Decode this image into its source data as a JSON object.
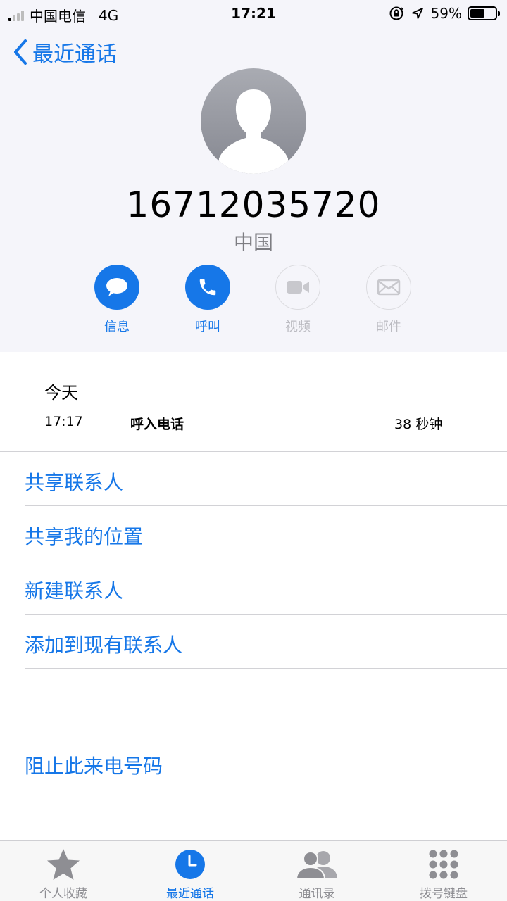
{
  "status_bar": {
    "carrier": "中国电信",
    "network": "4G",
    "time": "17:21",
    "battery_percent": "59%",
    "battery_level": 0.59,
    "signal_bars_active": 1,
    "signal_bars_total": 4
  },
  "nav": {
    "back_label": "最近通话"
  },
  "contact": {
    "number": "16712035720",
    "location": "中国"
  },
  "actions": [
    {
      "label": "信息",
      "icon": "message-icon",
      "enabled": true
    },
    {
      "label": "呼叫",
      "icon": "phone-icon",
      "enabled": true
    },
    {
      "label": "视频",
      "icon": "video-icon",
      "enabled": false
    },
    {
      "label": "邮件",
      "icon": "mail-icon",
      "enabled": false
    }
  ],
  "call_log": {
    "day": "今天",
    "entries": [
      {
        "time": "17:17",
        "type": "呼入电话",
        "duration": "38 秒钟"
      }
    ]
  },
  "options": {
    "share_contact": "共享联系人",
    "share_location": "共享我的位置",
    "new_contact": "新建联系人",
    "add_to_existing": "添加到现有联系人",
    "block_caller": "阻止此来电号码"
  },
  "tabs": [
    {
      "label": "个人收藏",
      "icon": "star-icon",
      "active": false
    },
    {
      "label": "最近通话",
      "icon": "clock-icon",
      "active": true
    },
    {
      "label": "通讯录",
      "icon": "contacts-icon",
      "active": false
    },
    {
      "label": "拨号键盘",
      "icon": "keypad-icon",
      "active": false
    }
  ],
  "colors": {
    "accent": "#1677e8",
    "header_bg": "#f5f5fa",
    "disabled": "#bcbcc2",
    "divider": "#d2d2d6"
  }
}
